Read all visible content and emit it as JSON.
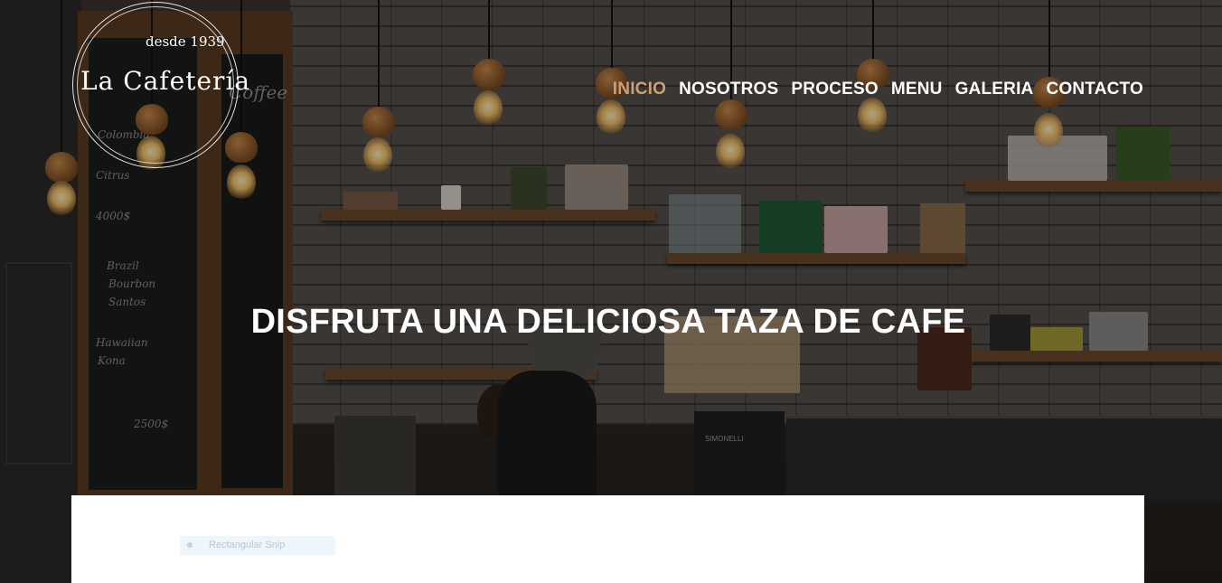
{
  "brand": {
    "since": "desde 1939",
    "name": "La Cafetería"
  },
  "nav": {
    "items": [
      {
        "label": "INICIO",
        "active": true
      },
      {
        "label": "NOSOTROS",
        "active": false
      },
      {
        "label": "PROCESO",
        "active": false
      },
      {
        "label": "MENU",
        "active": false
      },
      {
        "label": "GALERIA",
        "active": false
      },
      {
        "label": "CONTACTO",
        "active": false
      }
    ],
    "active_color": "#c9a072"
  },
  "hero": {
    "headline": "DISFRUTA UNA DELICIOSA TAZA DE CAFE"
  },
  "content": {
    "snip_label": "Rectangular Snip"
  }
}
